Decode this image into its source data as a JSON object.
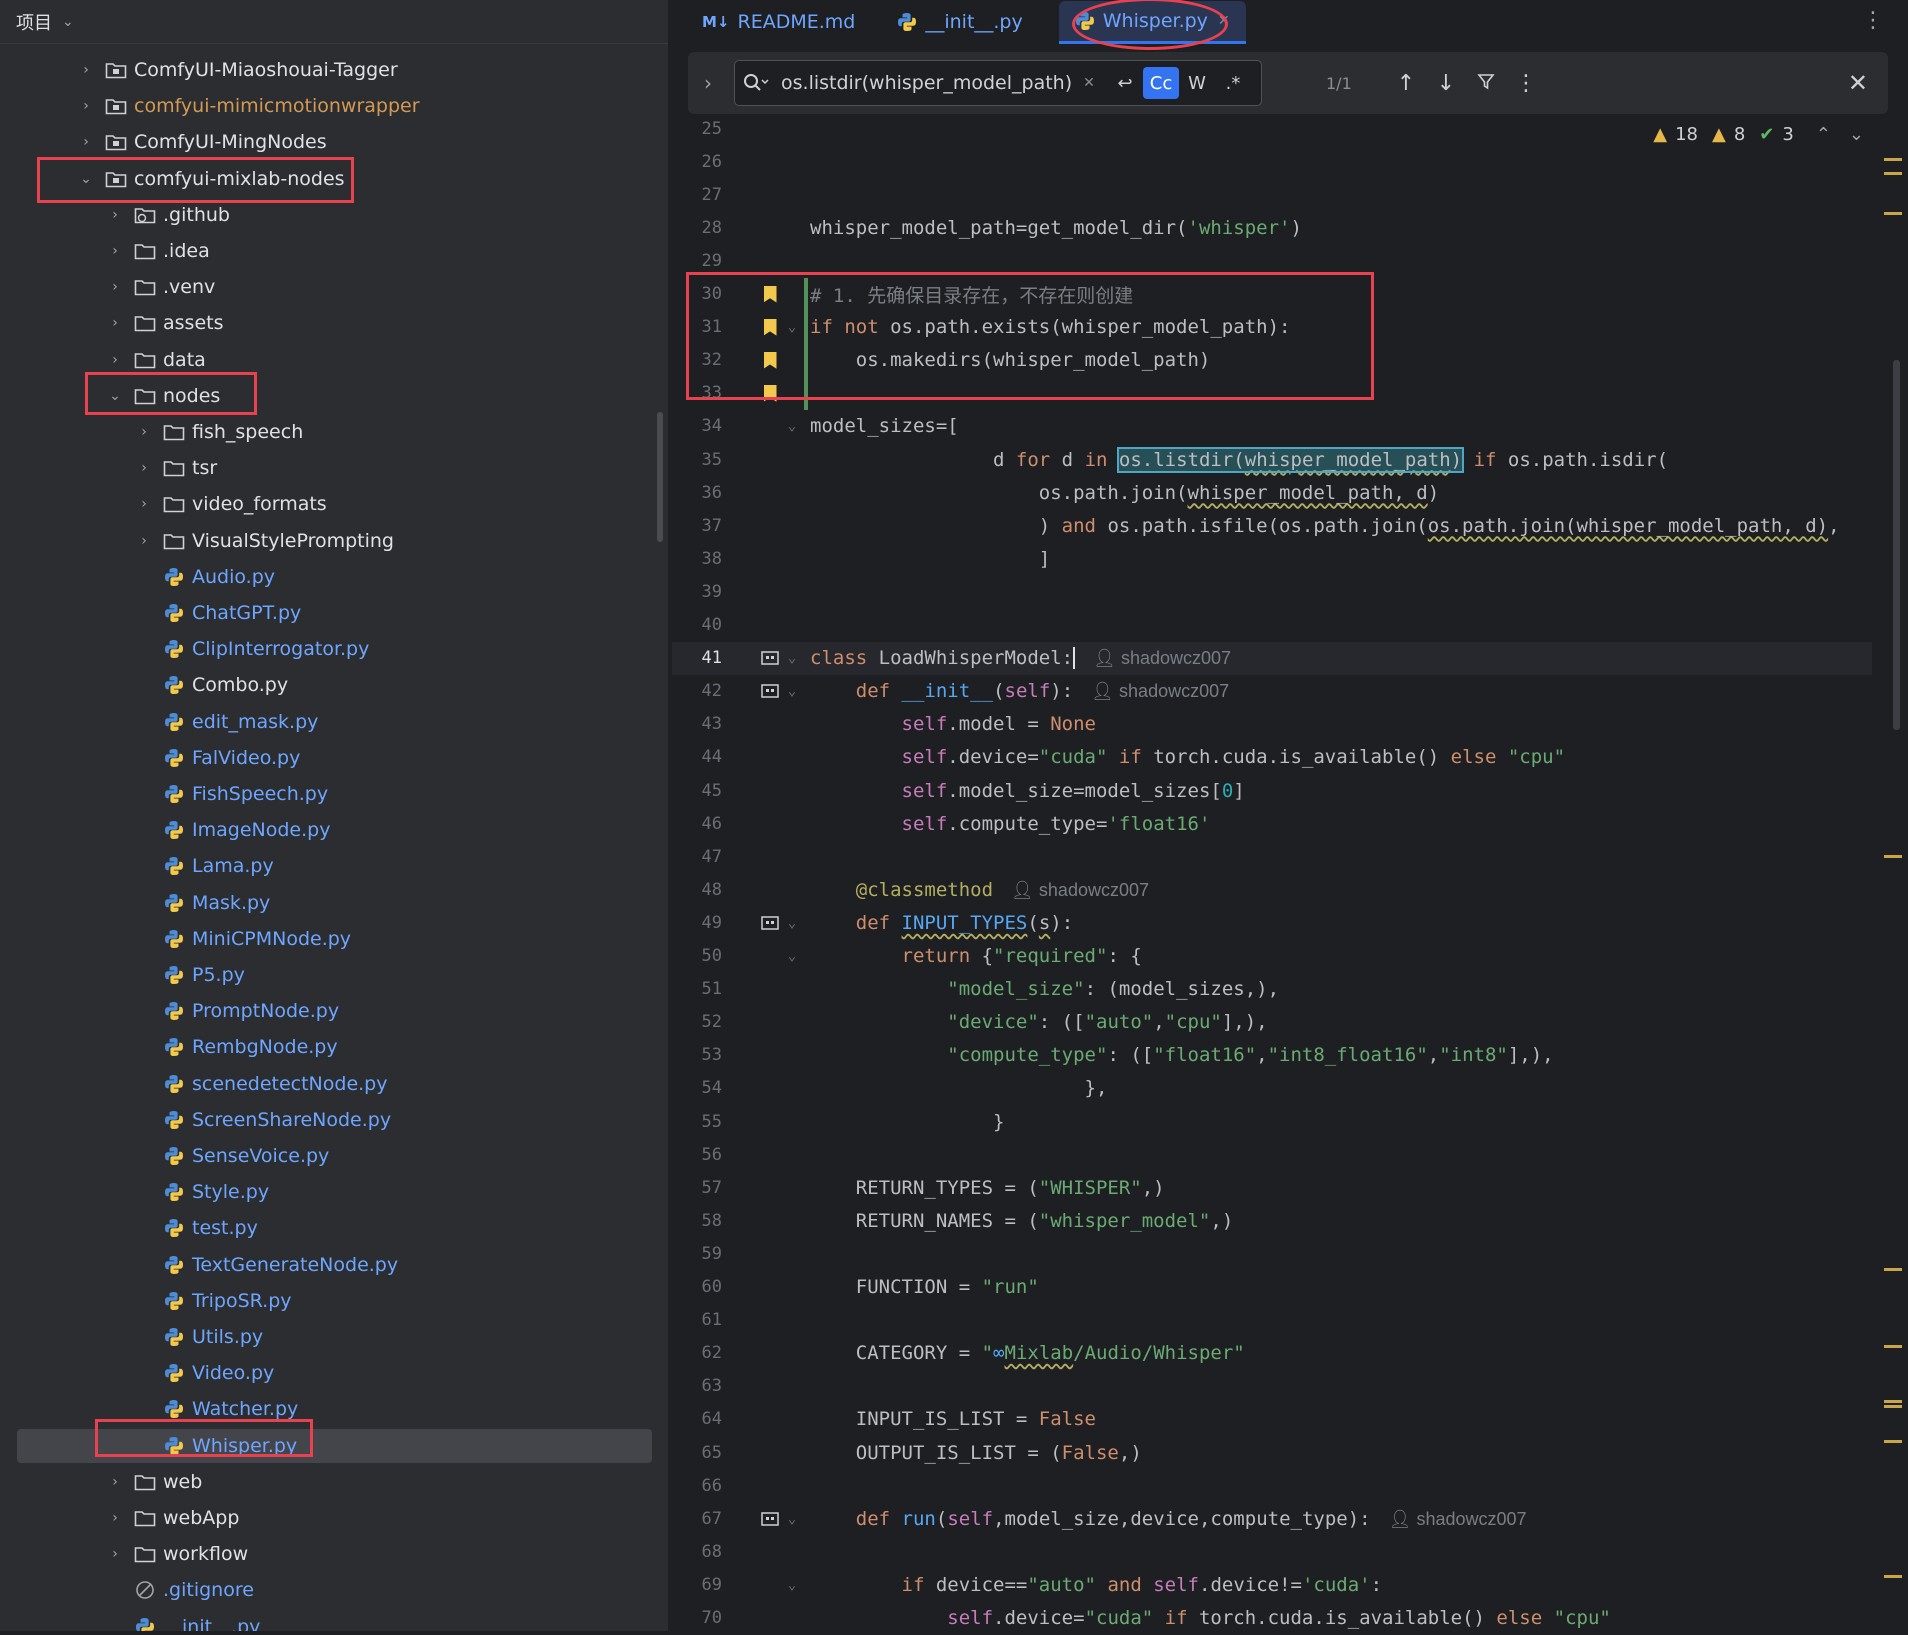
{
  "sidebar": {
    "title": "项目",
    "items": [
      {
        "label": "ComfyUI-Miaoshouai-Tagger",
        "level": 0,
        "kind": "module",
        "expanded": false,
        "style": "normal"
      },
      {
        "label": "comfyui-mimicmotionwrapper",
        "level": 0,
        "kind": "module",
        "expanded": false,
        "style": "orange"
      },
      {
        "label": "ComfyUI-MingNodes",
        "level": 0,
        "kind": "module",
        "expanded": false,
        "style": "normal"
      },
      {
        "label": "comfyui-mixlab-nodes",
        "level": 0,
        "kind": "module",
        "expanded": true,
        "style": "normal"
      },
      {
        "label": ".github",
        "level": 1,
        "kind": "github",
        "expanded": false,
        "style": "normal"
      },
      {
        "label": ".idea",
        "level": 1,
        "kind": "folder",
        "expanded": false,
        "style": "normal"
      },
      {
        "label": ".venv",
        "level": 1,
        "kind": "folder",
        "expanded": false,
        "style": "normal"
      },
      {
        "label": "assets",
        "level": 1,
        "kind": "folder",
        "expanded": false,
        "style": "normal"
      },
      {
        "label": "data",
        "level": 1,
        "kind": "folder",
        "expanded": false,
        "style": "normal"
      },
      {
        "label": "nodes",
        "level": 1,
        "kind": "folder",
        "expanded": true,
        "style": "normal"
      },
      {
        "label": "fish_speech",
        "level": 2,
        "kind": "folder",
        "expanded": false,
        "style": "normal"
      },
      {
        "label": "tsr",
        "level": 2,
        "kind": "folder",
        "expanded": false,
        "style": "normal"
      },
      {
        "label": "video_formats",
        "level": 2,
        "kind": "folder",
        "expanded": false,
        "style": "normal"
      },
      {
        "label": "VisualStylePrompting",
        "level": 2,
        "kind": "folder",
        "expanded": false,
        "style": "normal"
      },
      {
        "label": "Audio.py",
        "level": 2,
        "kind": "py",
        "style": "py"
      },
      {
        "label": "ChatGPT.py",
        "level": 2,
        "kind": "py",
        "style": "py"
      },
      {
        "label": "ClipInterrogator.py",
        "level": 2,
        "kind": "py",
        "style": "py"
      },
      {
        "label": "Combo.py",
        "level": 2,
        "kind": "py",
        "style": "normal"
      },
      {
        "label": "edit_mask.py",
        "level": 2,
        "kind": "py",
        "style": "py"
      },
      {
        "label": "FalVideo.py",
        "level": 2,
        "kind": "py",
        "style": "py"
      },
      {
        "label": "FishSpeech.py",
        "level": 2,
        "kind": "py",
        "style": "py"
      },
      {
        "label": "ImageNode.py",
        "level": 2,
        "kind": "py",
        "style": "py"
      },
      {
        "label": "Lama.py",
        "level": 2,
        "kind": "py",
        "style": "py"
      },
      {
        "label": "Mask.py",
        "level": 2,
        "kind": "py",
        "style": "py"
      },
      {
        "label": "MiniCPMNode.py",
        "level": 2,
        "kind": "py",
        "style": "py"
      },
      {
        "label": "P5.py",
        "level": 2,
        "kind": "py",
        "style": "py"
      },
      {
        "label": "PromptNode.py",
        "level": 2,
        "kind": "py",
        "style": "py"
      },
      {
        "label": "RembgNode.py",
        "level": 2,
        "kind": "py",
        "style": "py"
      },
      {
        "label": "scenedetectNode.py",
        "level": 2,
        "kind": "py",
        "style": "py"
      },
      {
        "label": "ScreenShareNode.py",
        "level": 2,
        "kind": "py",
        "style": "py"
      },
      {
        "label": "SenseVoice.py",
        "level": 2,
        "kind": "py",
        "style": "py"
      },
      {
        "label": "Style.py",
        "level": 2,
        "kind": "py",
        "style": "py"
      },
      {
        "label": "test.py",
        "level": 2,
        "kind": "py",
        "style": "py"
      },
      {
        "label": "TextGenerateNode.py",
        "level": 2,
        "kind": "py",
        "style": "py"
      },
      {
        "label": "TripoSR.py",
        "level": 2,
        "kind": "py",
        "style": "py"
      },
      {
        "label": "Utils.py",
        "level": 2,
        "kind": "py",
        "style": "py"
      },
      {
        "label": "Video.py",
        "level": 2,
        "kind": "py",
        "style": "py"
      },
      {
        "label": "Watcher.py",
        "level": 2,
        "kind": "py",
        "style": "py"
      },
      {
        "label": "Whisper.py",
        "level": 2,
        "kind": "py",
        "style": "py",
        "selected": true
      },
      {
        "label": "web",
        "level": 1,
        "kind": "folder",
        "expanded": false,
        "style": "normal"
      },
      {
        "label": "webApp",
        "level": 1,
        "kind": "folder",
        "expanded": false,
        "style": "normal"
      },
      {
        "label": "workflow",
        "level": 1,
        "kind": "folder",
        "expanded": false,
        "style": "normal"
      },
      {
        "label": ".gitignore",
        "level": 1,
        "kind": "ignore",
        "style": "gitig"
      },
      {
        "label": "__init__.py",
        "level": 1,
        "kind": "py",
        "style": "py"
      }
    ]
  },
  "tabs": [
    {
      "label": "README.md",
      "icon": "markdown-icon",
      "active": false
    },
    {
      "label": "__init__.py",
      "icon": "python-icon",
      "active": false
    },
    {
      "label": "Whisper.py",
      "icon": "python-icon",
      "active": true
    }
  ],
  "find": {
    "query": "os.listdir(whisper_model_path)",
    "count": "1/1",
    "match_case": "Cc",
    "words": "W",
    "regex": ".*"
  },
  "inspections": {
    "warnings": "18",
    "weak_warnings": "8",
    "typos": "3"
  },
  "colors": {
    "accent": "#3574f0",
    "highlight_red": "#e8414f",
    "bookmark": "#f2c94c"
  },
  "code": {
    "author": "shadowcz007",
    "lines": [
      {
        "n": "25"
      },
      {
        "n": "26"
      },
      {
        "n": "27"
      },
      {
        "n": "28",
        "html": "whisper_model_path=get_model_dir(<span class='str'>'whisper'</span>)"
      },
      {
        "n": "29"
      },
      {
        "n": "30",
        "html": "<span class='cmt'># 1. 先确保目录存在，不存在则创建</span>",
        "bookmark": true,
        "change": true
      },
      {
        "n": "31",
        "html": "<span class='kw'>if not</span> os.path.exists(whisper_model_path):",
        "bookmark": true,
        "fold": true,
        "change": true
      },
      {
        "n": "32",
        "html": "    os.makedirs(whisper_model_path)",
        "bookmark": true,
        "change": true
      },
      {
        "n": "33",
        "bookmark": true,
        "change": true
      },
      {
        "n": "34",
        "html": "model_sizes=[",
        "fold": true
      },
      {
        "n": "35",
        "html": "                d <span class='kw'>for</span> d <span class='kw'>in</span> <span class='match'>os.listdir(<span class='squig'>whisper_model_path</span>)</span> <span class='kw'>if</span> os.path.isdir("
      },
      {
        "n": "36",
        "html": "                    os.path.join(<span class='squig'>whisper_model_path, d</span>)"
      },
      {
        "n": "37",
        "html": "                    ) <span class='kw'>and</span> os.path.isfile(os.path.join(<span class='squig'>os.path.join(whisper_model_path, d)</span>,"
      },
      {
        "n": "38",
        "html": "                    ]"
      },
      {
        "n": "39"
      },
      {
        "n": "40"
      },
      {
        "n": "41",
        "html": "<span class='kw'>class</span> LoadWhisperModel:",
        "cursor": true,
        "author": true,
        "gutter_icon": true,
        "fold": true,
        "current": true
      },
      {
        "n": "42",
        "html": "    <span class='kw'>def</span> <span class='fn'>__init__</span>(<span class='slf'>self</span>):",
        "author": true,
        "gutter_icon": true,
        "fold": true
      },
      {
        "n": "43",
        "html": "        <span class='slf'>self</span>.model = <span class='kw'>None</span>"
      },
      {
        "n": "44",
        "html": "        <span class='slf'>self</span>.device=<span class='str'>\"cuda\"</span> <span class='kw'>if</span> torch.cuda.is_available() <span class='kw'>else</span> <span class='str'>\"cpu\"</span>"
      },
      {
        "n": "45",
        "html": "        <span class='slf'>self</span>.model_size=model_sizes[<span class='num'>0</span>]"
      },
      {
        "n": "46",
        "html": "        <span class='slf'>self</span>.compute_type=<span class='str'>'float16'</span>"
      },
      {
        "n": "47"
      },
      {
        "n": "48",
        "html": "    <span class='dec'>@classmethod</span>",
        "author": true
      },
      {
        "n": "49",
        "html": "    <span class='kw'>def</span> <span class='fn squig'>INPUT_TYPES</span>(<span class='squig'>s</span>):",
        "gutter_icon": true,
        "fold": true
      },
      {
        "n": "50",
        "html": "        <span class='kw'>return</span> {<span class='str'>\"required\"</span>: {",
        "fold": true
      },
      {
        "n": "51",
        "html": "            <span class='str'>\"model_size\"</span>: (model_sizes,),"
      },
      {
        "n": "52",
        "html": "            <span class='str'>\"device\"</span>: ([<span class='str'>\"auto\"</span>,<span class='str'>\"cpu\"</span>],),"
      },
      {
        "n": "53",
        "html": "            <span class='str'>\"compute_type\"</span>: ([<span class='str'>\"float16\"</span>,<span class='str'>\"int8_float16\"</span>,<span class='str'>\"int8\"</span>],),"
      },
      {
        "n": "54",
        "html": "                        },"
      },
      {
        "n": "55",
        "html": "                }"
      },
      {
        "n": "56"
      },
      {
        "n": "57",
        "html": "    RETURN_TYPES = (<span class='str'>\"WHISPER\"</span>,)"
      },
      {
        "n": "58",
        "html": "    RETURN_NAMES = (<span class='str'>\"whisper_model\"</span>,)"
      },
      {
        "n": "59"
      },
      {
        "n": "60",
        "html": "    FUNCTION = <span class='str'>\"run\"</span>"
      },
      {
        "n": "61"
      },
      {
        "n": "62",
        "html": "    CATEGORY = <span class='str'>\"<span style='color:#56a8f5'>∞</span><span class='squig'>Mixlab</span>/Audio/Whisper\"</span>"
      },
      {
        "n": "63"
      },
      {
        "n": "64",
        "html": "    INPUT_IS_LIST = <span class='kw'>False</span>"
      },
      {
        "n": "65",
        "html": "    OUTPUT_IS_LIST = (<span class='kw'>False</span>,)"
      },
      {
        "n": "66"
      },
      {
        "n": "67",
        "html": "    <span class='kw'>def</span> <span class='fn'>run</span>(<span class='slf'>self</span>,model_size,device,compute_type):",
        "author": true,
        "gutter_icon": true,
        "fold": true
      },
      {
        "n": "68"
      },
      {
        "n": "69",
        "html": "        <span class='kw'>if</span> device==<span class='str'>\"auto\"</span> <span class='kw'>and</span> <span class='slf'>self</span>.device!=<span class='str'>'cuda'</span>:",
        "fold": true
      },
      {
        "n": "70",
        "html": "            <span class='slf'>self</span>.device=<span class='str'>\"cuda\"</span> <span class='kw'>if</span> torch.cuda.is_available() <span class='kw'>else</span> <span class='str'>\"cpu\"</span>"
      }
    ]
  }
}
